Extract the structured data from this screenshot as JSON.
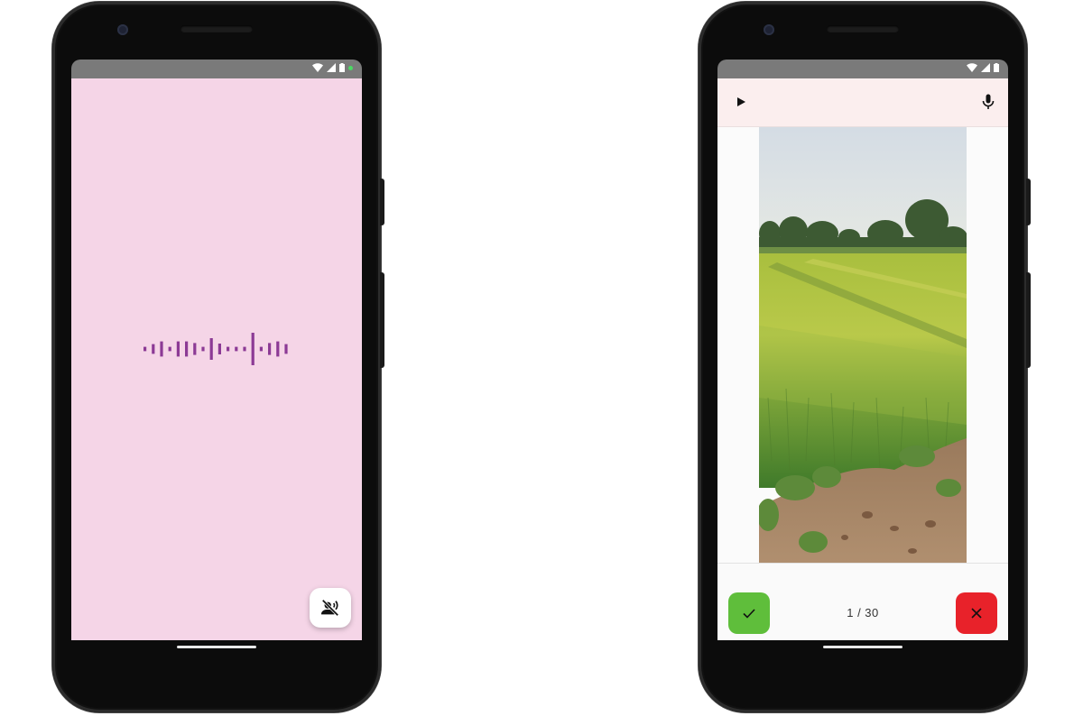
{
  "colors": {
    "left_background": "#f5d5e7",
    "waveform": "#8c3a95",
    "accept": "#5fbe3b",
    "reject": "#e8222a",
    "topbar": "#fbeeee"
  },
  "left_screen": {
    "status_icons": [
      "wifi-icon",
      "signal-icon",
      "battery-icon"
    ],
    "waveform_levels": [
      0.2,
      0.45,
      0.7,
      0.2,
      0.7,
      0.7,
      0.55,
      0.2,
      1.0,
      0.5,
      0.2,
      0.2,
      0.2,
      1.5,
      0.2,
      0.55,
      0.7,
      0.45
    ],
    "fab_icon": "voice-off-icon"
  },
  "right_screen": {
    "status_icons": [
      "wifi-icon",
      "signal-icon",
      "battery-icon"
    ],
    "play_icon": "play-icon",
    "mic_icon": "mic-icon",
    "counter": "1 / 30",
    "accept_icon": "check-icon",
    "reject_icon": "close-icon"
  }
}
